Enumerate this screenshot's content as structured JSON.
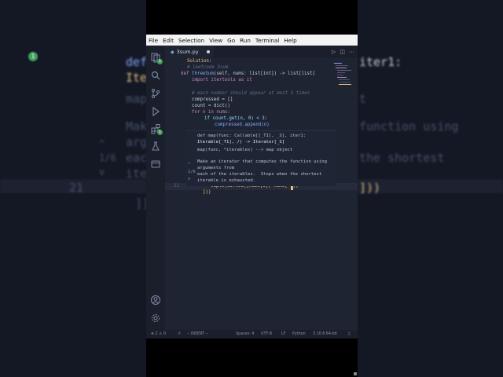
{
  "menubar": {
    "items": [
      "File",
      "Edit",
      "Selection",
      "View",
      "Go",
      "Run",
      "Terminal",
      "Help"
    ]
  },
  "tab": {
    "filename": "3sum.py",
    "lang_glyph": "◆"
  },
  "tab_actions": {
    "run": "▷",
    "split": "◫",
    "more": "⋯"
  },
  "activity_badges": {
    "explorer": "1",
    "extensions": "1"
  },
  "code": {
    "line1": "Solution:",
    "line2": "# leetcode 3sum",
    "line3_def": "def ",
    "line3_fn": "threeSum",
    "line3_rest": "(self, nums: list[int]) -> list[list[",
    "line4": "import itertools as it",
    "line5": "# each number should appear at most 3 times",
    "line6": "compressed = []",
    "line7": "count = dict()",
    "line8": "for n in nums:",
    "line9": "if count.get(n, 0) < 3:",
    "line10": "compressed.append(n)",
    "line21_num": "21",
    "line21": "tuple(sorted([nums[i], nums[ ]))",
    "line22": "]))"
  },
  "tooltip": {
    "nav_up": "^",
    "counter": "1/6",
    "nav_down": "v",
    "sig1": "def map(func: Callable[[_T1], _S], iter1:",
    "sig2": "Iterable[_T1], /) -> Iterator[_S]",
    "sig3": "map(func, *iterables) --> map object",
    "doc1": "Make an iterator that computes the function using",
    "doc2": "arguments from",
    "doc3": "each of the iterables.  Stops when the shortest",
    "doc4": "iterable is exhausted."
  },
  "statusbar": {
    "errors": "⊗ 2 ⚠ 0",
    "mode": "-- INSERT --",
    "spaces": "Spaces: 4",
    "encoding": "UTF-8",
    "eol": "LF",
    "language": "Python",
    "version": "3.10.6 64-bit"
  },
  "background": {
    "left_lines": [
      "def",
      "Iteral",
      "map(",
      "Make",
      "argu",
      "each",
      "itera",
      "21",
      "]])"
    ],
    "left_counter": "1/6",
    "right_lines": [
      "iter1:",
      "t",
      "function using",
      "the shortest",
      "]))"
    ]
  }
}
